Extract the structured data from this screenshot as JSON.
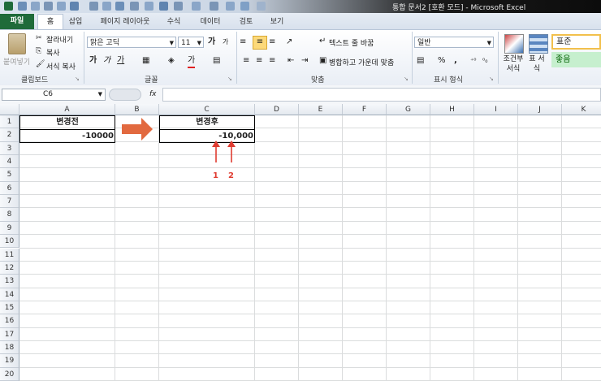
{
  "window": {
    "title": "통합 문서2 [호환 모드] - Microsoft Excel"
  },
  "tabs": [
    "파일",
    "홈",
    "삽입",
    "페이지 레이아웃",
    "수식",
    "데이터",
    "검토",
    "보기"
  ],
  "clipboard": {
    "paste": "붙여넣기",
    "cut": "잘라내기",
    "copy": "복사",
    "format_painter": "서식 복사",
    "group": "클립보드"
  },
  "font": {
    "name": "맑은 고딕",
    "size": "11",
    "group": "글꼴",
    "bold": "가",
    "italic": "가",
    "underline": "가",
    "color": "가",
    "grow": "가",
    "shrink": "가"
  },
  "alignment": {
    "wrap": "텍스트 줄 바꿈",
    "merge": "병합하고 가운데 맞춤",
    "group": "맞춤"
  },
  "number": {
    "format": "일반",
    "percent": "%",
    "comma": ",",
    "group": "표시 형식"
  },
  "styles": {
    "conditional": "조건부 서식",
    "table": "표 서식",
    "normal": "표준",
    "good": "좋음"
  },
  "formula_bar": {
    "name_box": "C6",
    "fx": "fx",
    "formula": ""
  },
  "columns": [
    "A",
    "B",
    "C",
    "D",
    "E",
    "F",
    "G",
    "H",
    "I",
    "J",
    "K"
  ],
  "rows": [
    "1",
    "2",
    "3",
    "4",
    "5",
    "6",
    "7",
    "8",
    "9",
    "10",
    "11",
    "12",
    "13",
    "14",
    "15",
    "16",
    "17",
    "18",
    "19",
    "20"
  ],
  "cells": {
    "A1": "변경전",
    "A2": "-10000",
    "C1": "변경후",
    "C2": "-10,000"
  },
  "annotations": {
    "label1": "1",
    "label2": "2",
    "color": "#e03c31",
    "arrow_color": "#e2693f"
  }
}
